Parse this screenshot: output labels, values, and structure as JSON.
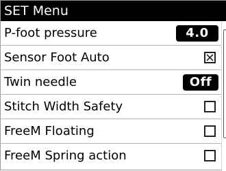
{
  "menu": {
    "title": "SET Menu",
    "items": [
      {
        "label": "P-foot pressure",
        "value": "4.0"
      },
      {
        "label": "Sensor Foot Auto",
        "checked": true
      },
      {
        "label": "Twin needle",
        "value": "Off"
      },
      {
        "label": "Stitch Width Safety",
        "checked": false
      },
      {
        "label": "FreeM Floating",
        "checked": false
      },
      {
        "label": "FreeM Spring action",
        "checked": false
      }
    ]
  },
  "colors": {
    "title_background": "#000000",
    "title_text": "#ffffff",
    "value_pill_background": "#000000",
    "list_background": "#ffffff"
  }
}
